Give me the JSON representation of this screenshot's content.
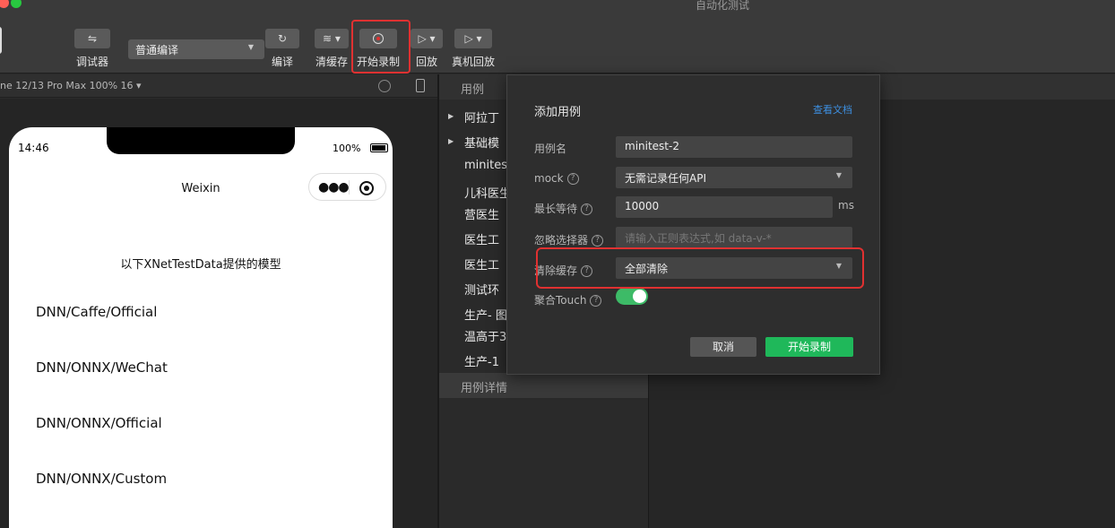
{
  "window": {
    "title": "自动化测试"
  },
  "toolbar": {
    "debugger_label": "调试器",
    "compile_mode": "普通编译",
    "compile_label": "编译",
    "clear_cache_label": "清缓存",
    "start_record_label": "开始录制",
    "replay_label": "回放",
    "device_replay_label": "真机回放",
    "highlight_color": "#e03131"
  },
  "simulator": {
    "device": "ne 12/13 Pro Max 100% 16 ▾",
    "status_time": "14:46",
    "battery": "100%",
    "nav_title": "Weixin",
    "heading": "以下XNetTestData提供的模型",
    "models": [
      "DNN/Caffe/Official",
      "DNN/ONNX/WeChat",
      "DNN/ONNX/Official",
      "DNN/ONNX/Custom"
    ]
  },
  "cases": {
    "header": "用例",
    "items": [
      "阿拉丁",
      "基础模",
      "minites",
      "儿科医生",
      "营医生",
      "医生工",
      "医生工",
      "测试环",
      "生产- 图",
      "温高于3",
      "生产-1"
    ],
    "details_header": "用例详情"
  },
  "dialog": {
    "title": "添加用例",
    "doc_link": "查看文档",
    "name_label": "用例名",
    "name_value": "minitest-2",
    "mock_label": "mock",
    "mock_value": "无需记录任何API",
    "wait_label": "最长等待",
    "wait_value": "10000",
    "wait_unit": "ms",
    "ignore_label": "忽略选择器",
    "ignore_placeholder": "请输入正则表达式,如 data-v-*",
    "clear_cache_label": "清除缓存",
    "clear_cache_value": "全部清除",
    "touch_label": "聚合Touch",
    "touch_enabled": true,
    "cancel_label": "取消",
    "start_label": "开始录制",
    "accent_color": "#1fb85a"
  }
}
